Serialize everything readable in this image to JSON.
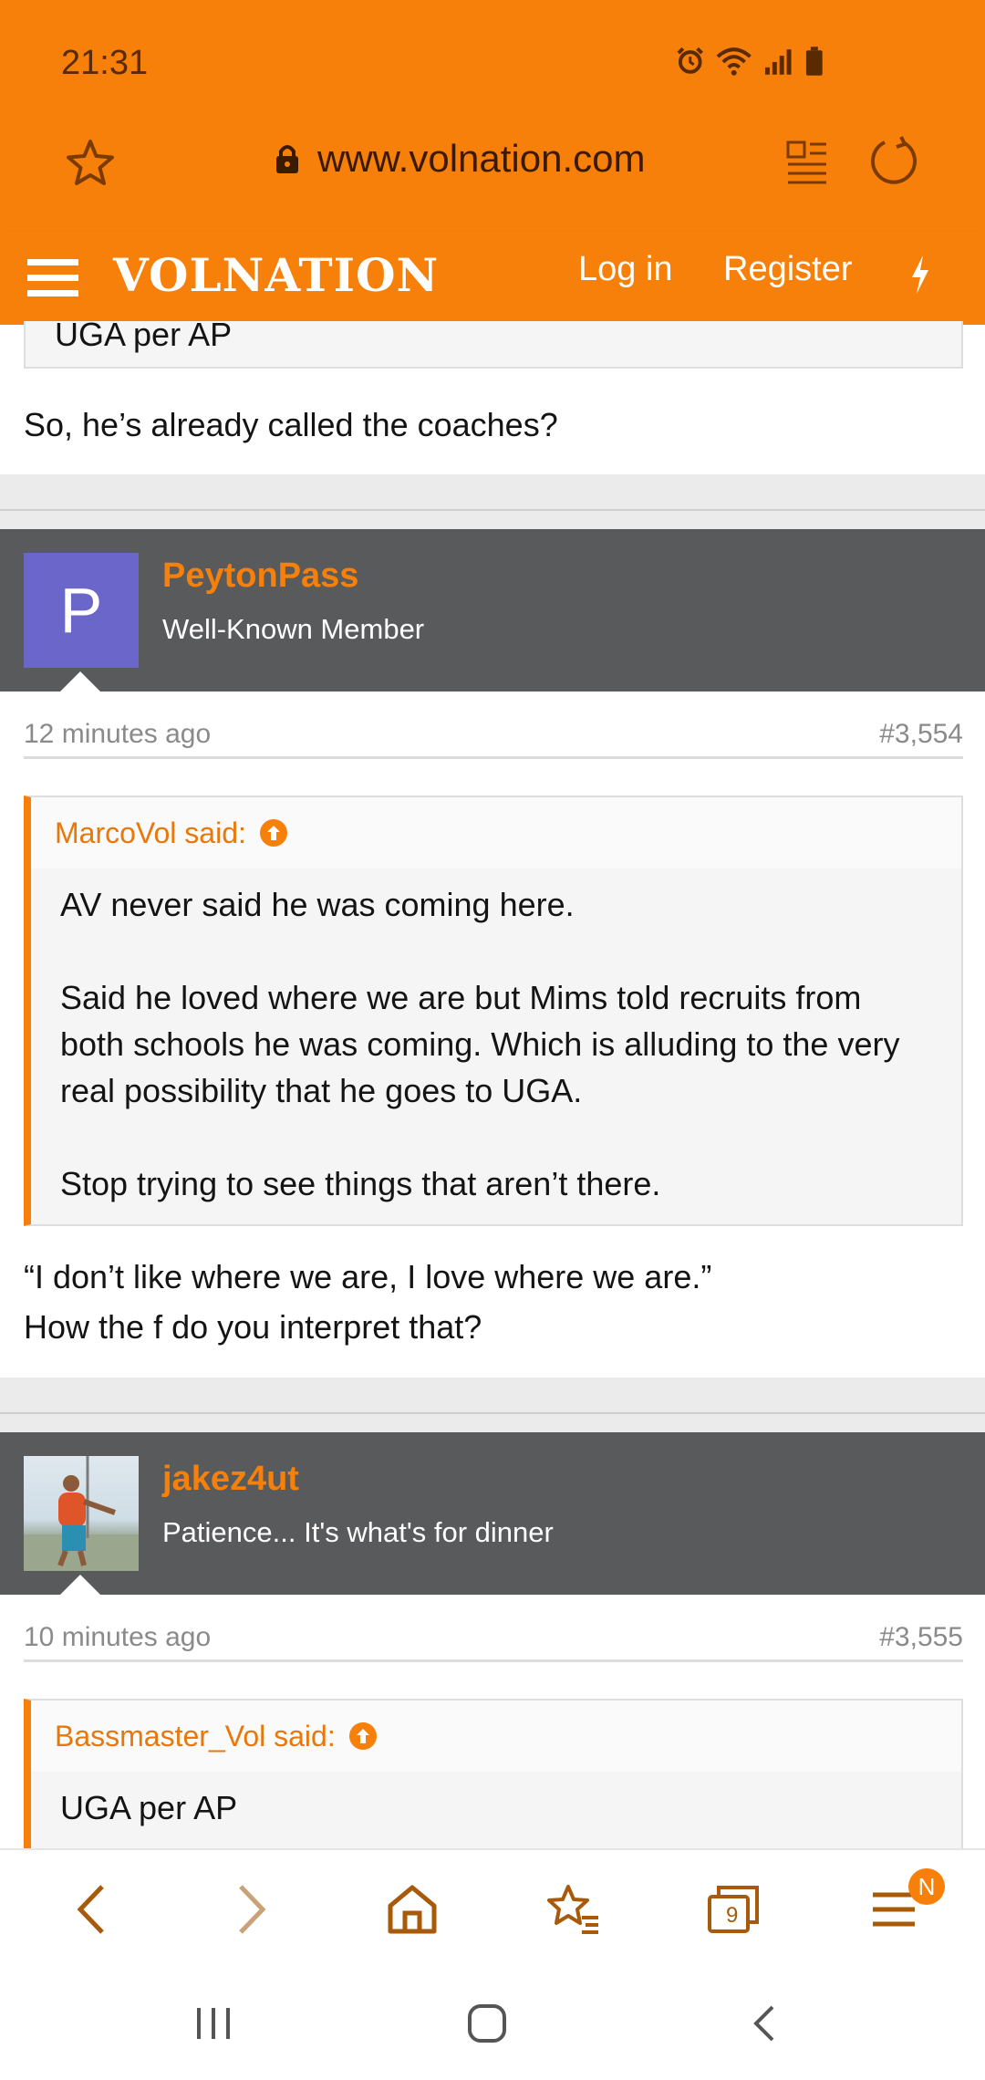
{
  "status": {
    "time": "21:31"
  },
  "browser": {
    "url": "www.volnation.com"
  },
  "header": {
    "logo": "VOLNATION",
    "login": "Log in",
    "register": "Register"
  },
  "top_post": {
    "quote_tail": "UGA per AP",
    "body": "So, he’s already called the coaches?"
  },
  "post1": {
    "avatar_letter": "P",
    "avatar_color": "#6b66c9",
    "author": "PeytonPass",
    "title": "Well-Known Member",
    "time": "12 minutes ago",
    "number": "#3,554",
    "quote_author": "MarcoVol said:",
    "quote_p1": "AV never said he was coming here.",
    "quote_p2": "Said he loved where we are but Mims told recruits from both schools he was coming. Which is alluding to the very real possibility that he goes to UGA.",
    "quote_p3": "Stop trying to see things that aren’t there.",
    "body_line1": "“I don’t like where we are, I love where we are.”",
    "body_line2": "How the f do you interpret that?"
  },
  "post2": {
    "author": "jakez4ut",
    "title": "Patience... It's what's for dinner",
    "time": "10 minutes ago",
    "number": "#3,555",
    "quote_author": "Bassmaster_Vol said:",
    "quote_p1": "UGA per AP"
  },
  "toolbar": {
    "tabs_count": "9",
    "menu_badge": "N",
    "accent": "#f6800a",
    "icon_color": "#a65a0a"
  }
}
